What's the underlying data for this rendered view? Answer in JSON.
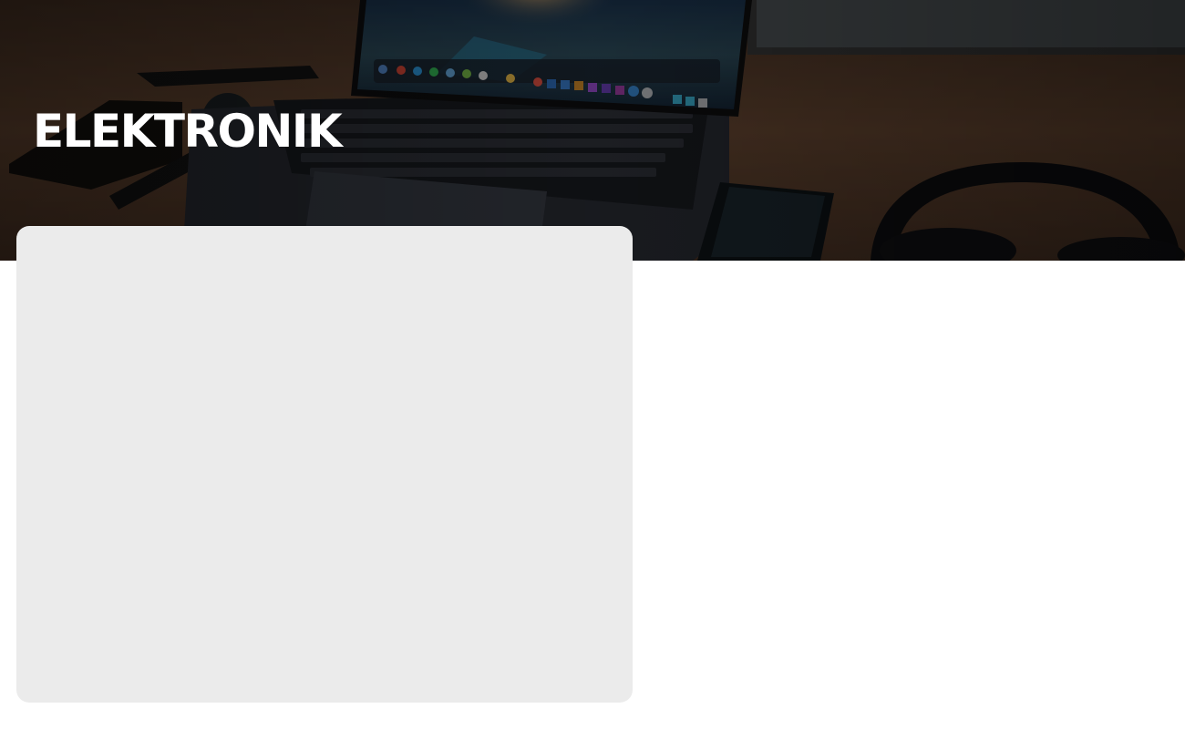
{
  "hero": {
    "title": "ELEKTRONIK",
    "image": "electronics-desk-banner"
  },
  "colors": {
    "card_background": "#ebebeb",
    "page_background": "#ffffff",
    "title_color": "#ffffff"
  }
}
